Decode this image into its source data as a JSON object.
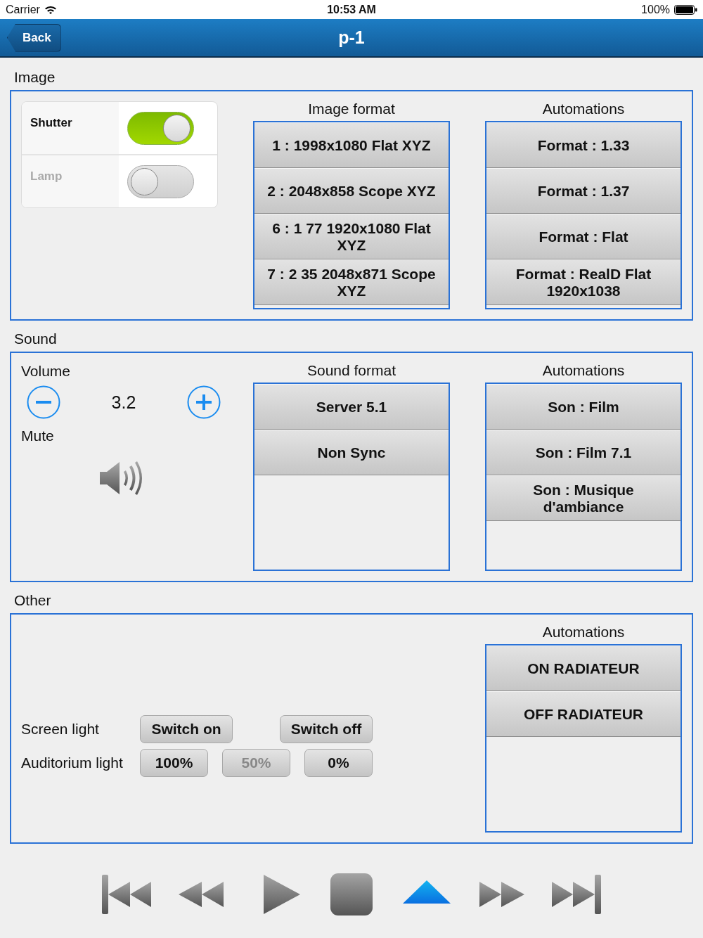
{
  "status_bar": {
    "carrier": "Carrier",
    "time": "10:53 AM",
    "battery": "100%"
  },
  "nav_bar": {
    "back": "Back",
    "title": "p-1"
  },
  "sections": [
    {
      "kind": "image",
      "title": "Image",
      "toggles": [
        {
          "label": "Shutter",
          "on": true,
          "disabled": false
        },
        {
          "label": "Lamp",
          "on": false,
          "disabled": true
        }
      ],
      "lists": [
        {
          "title": "Image format",
          "items": [
            "1 : 1998x1080 Flat XYZ",
            "2 : 2048x858 Scope XYZ",
            "6 : 1 77 1920x1080 Flat XYZ",
            "7 : 2 35 2048x871 Scope XYZ"
          ]
        },
        {
          "title": "Automations",
          "items": [
            "Format : 1.33",
            "Format : 1.37",
            "Format : Flat",
            "Format : RealD Flat 1920x1038"
          ]
        }
      ]
    },
    {
      "kind": "sound",
      "title": "Sound",
      "volume": {
        "label": "Volume",
        "value": "3.2"
      },
      "mute": {
        "label": "Mute"
      },
      "lists": [
        {
          "title": "Sound format",
          "items": [
            "Server 5.1",
            "Non Sync"
          ]
        },
        {
          "title": "Automations",
          "items": [
            "Son : Film",
            "Son : Film 7.1",
            "Son : Musique d'ambiance"
          ]
        }
      ]
    },
    {
      "kind": "other",
      "title": "Other",
      "controls": [
        {
          "label": "Screen light",
          "buttons": [
            {
              "label": "Switch on",
              "disabled": false
            },
            {
              "label": "Switch off",
              "disabled": false
            }
          ]
        },
        {
          "label": "Auditorium light",
          "buttons": [
            {
              "label": "100%",
              "disabled": false
            },
            {
              "label": "50%",
              "disabled": true
            },
            {
              "label": "0%",
              "disabled": false
            }
          ]
        }
      ],
      "lists": [
        {
          "title": "Automations",
          "items": [
            "ON RADIATEUR",
            "OFF RADIATEUR"
          ]
        }
      ]
    }
  ],
  "transport": [
    {
      "kind": "skip-back",
      "selected": false
    },
    {
      "kind": "rewind",
      "selected": false
    },
    {
      "kind": "play",
      "selected": false
    },
    {
      "kind": "stop",
      "selected": false
    },
    {
      "kind": "eject",
      "selected": true
    },
    {
      "kind": "fast-forward",
      "selected": false
    },
    {
      "kind": "skip-forward",
      "selected": false
    }
  ]
}
